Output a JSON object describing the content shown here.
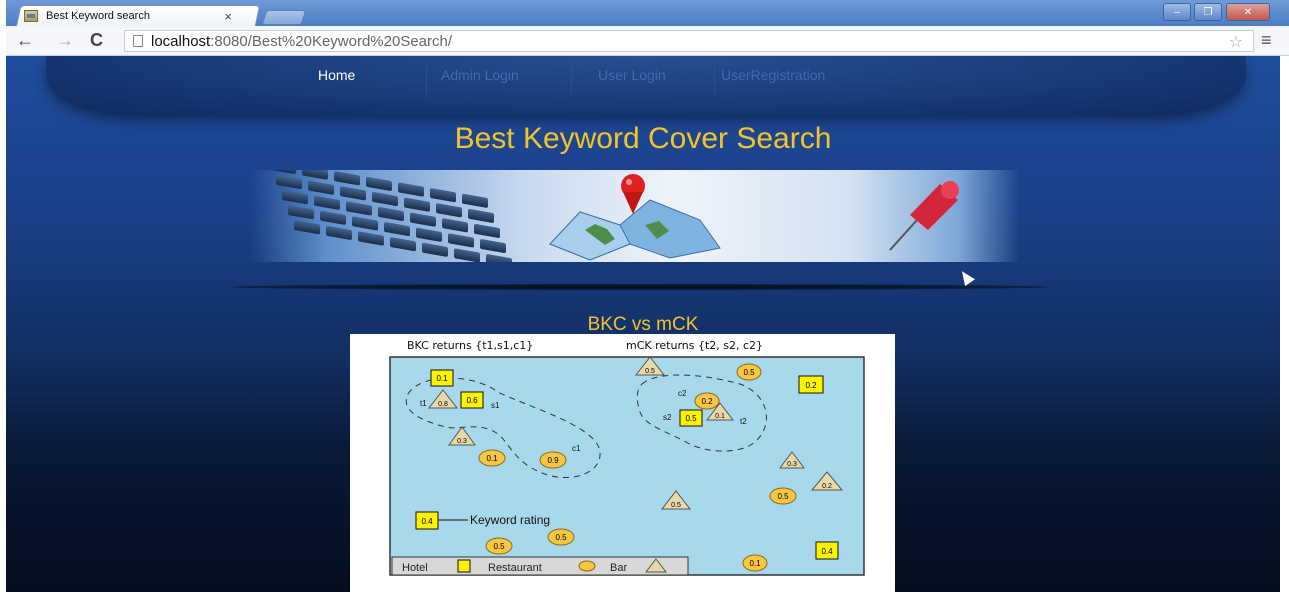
{
  "browser": {
    "tab_title": "Best Keyword search",
    "tab_close": "×",
    "url_host": "localhost",
    "url_path": ":8080/Best%20Keyword%20Search/",
    "back_icon": "←",
    "forward_icon": "→",
    "reload_icon": "C",
    "star_icon": "☆",
    "menu_icon": "≡",
    "min_icon": "–",
    "max_icon": "❐",
    "close_icon": "✕"
  },
  "nav": {
    "home": "Home",
    "admin_login": "Admin Login",
    "user_login": "User Login",
    "user_registration": "UserRegistration"
  },
  "site_title": "Best Keyword Cover Search",
  "section_title": "BKC vs mCK",
  "figure": {
    "bkc_caption": "BKC returns {t1,s1,c1}",
    "mck_caption": "mCK returns {t2, s2, c2}",
    "keyword_rating_label": "Keyword rating",
    "legend": {
      "hotel": "Hotel",
      "restaurant": "Restaurant",
      "bar": "Bar"
    },
    "hotels": [
      "0.1",
      "0.6",
      "0.5",
      "0.2",
      "0.4",
      "0.4"
    ],
    "restaurants": [
      "0.1",
      "0.9",
      "0.5",
      "0.2",
      "0.5",
      "0.5",
      "0.5",
      "0.1"
    ],
    "bars": [
      "0.8",
      "0.3",
      "0.5",
      "0.1",
      "0.3",
      "0.2",
      "0.5"
    ],
    "point_labels": [
      "t1",
      "s1",
      "c1",
      "c2",
      "s2",
      "t2"
    ]
  },
  "colors": {
    "map_bg": "#a8d8ec",
    "hotel_fill": "#fff200",
    "restaurant_fill": "#f7c744",
    "bar_fill": "#e8d9a8",
    "title_yellow": "#f4c32a"
  }
}
